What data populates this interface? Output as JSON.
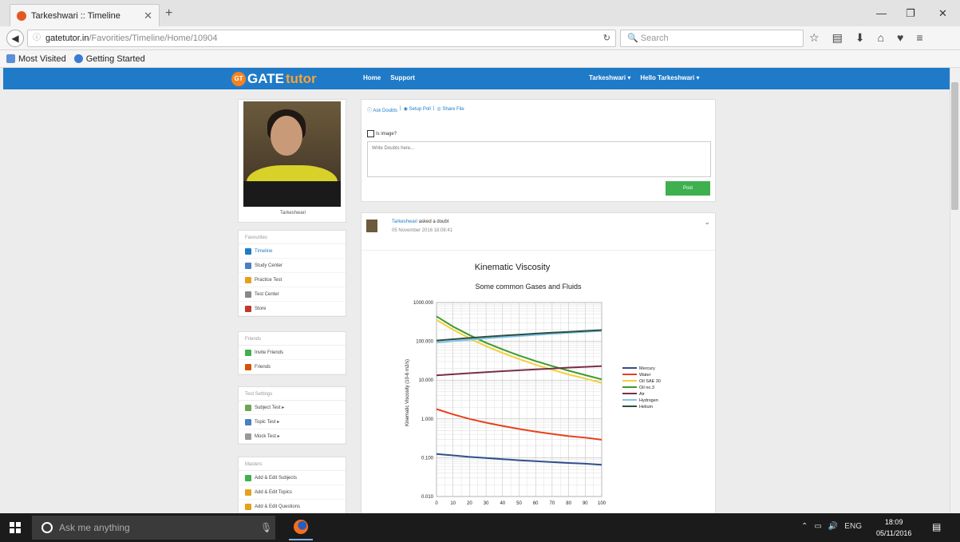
{
  "browser": {
    "tab_title": "Tarkeshwari :: Timeline",
    "url_host": "gatetutor.in",
    "url_path": "/Favorities/Timeline/Home/10904",
    "search_placeholder": "Search",
    "bookmarks": [
      "Most Visited",
      "Getting Started"
    ]
  },
  "site": {
    "logo_prefix": "GT",
    "logo_gate": "GATE",
    "logo_tutor": "tutor",
    "nav_left": [
      "Home",
      "Support"
    ],
    "nav_right": [
      "Tarkeshwari ▾",
      "Hello Tarkeshwari ▾"
    ]
  },
  "profile": {
    "name": "Tarkeshwari"
  },
  "sidebar": {
    "favourites": {
      "header": "Favourites",
      "items": [
        {
          "label": "Timeline",
          "color": "#1f7bc8"
        },
        {
          "label": "Study Center",
          "color": "#4a7fc1"
        },
        {
          "label": "Practice Test",
          "color": "#e3a21a"
        },
        {
          "label": "Test Center",
          "color": "#888888"
        },
        {
          "label": "Store",
          "color": "#c0392b"
        }
      ]
    },
    "friends": {
      "header": "Friends",
      "items": [
        {
          "label": "Invite Friends",
          "color": "#3eb04f"
        },
        {
          "label": "Friends",
          "color": "#d35400"
        }
      ]
    },
    "test_settings": {
      "header": "Test Settings",
      "items": [
        {
          "label": "Subject Test ▸",
          "color": "#6aa84f"
        },
        {
          "label": "Topic Test ▸",
          "color": "#4a7fc1"
        },
        {
          "label": "Mock Test ▸",
          "color": "#999999"
        }
      ]
    },
    "masters": {
      "header": "Masters",
      "items": [
        {
          "label": "Add & Edit Subjects",
          "color": "#3eb04f"
        },
        {
          "label": "Add & Edit Topics",
          "color": "#e3a21a"
        },
        {
          "label": "Add & Edit Questions",
          "color": "#e3a21a"
        }
      ]
    }
  },
  "composer": {
    "actions": [
      "Ask Doubts",
      "Setup Poll",
      "Share File"
    ],
    "is_image_label": "Is image?",
    "textarea_placeholder": "Write Doubts here...",
    "post_button": "Post"
  },
  "post": {
    "author": "Tarkeshwari",
    "action": "asked a doubt",
    "date": "05 November 2016 18:08:41"
  },
  "chart_data": {
    "type": "line",
    "title": "Kinematic Viscosity",
    "subtitle": "Some common Gases and Fluids",
    "ylabel": "Kinematic Viscosity (10-6 m2/s)",
    "xlabel": "",
    "xlim": [
      0,
      100
    ],
    "ylim": [
      0.01,
      1000
    ],
    "yscale": "log",
    "grid": true,
    "legend_position": "right",
    "x_ticks": [
      "0",
      "10",
      "20",
      "30",
      "40",
      "50",
      "60",
      "70",
      "80",
      "90",
      "100"
    ],
    "y_ticks": [
      "0.010",
      "0.100",
      "1.000",
      "10.000",
      "100.000",
      "1000.000"
    ],
    "x": [
      0,
      10,
      20,
      30,
      40,
      50,
      60,
      70,
      80,
      90,
      100
    ],
    "series": [
      {
        "name": "Mercury",
        "color": "#2e4f8c",
        "values": [
          0.125,
          0.115,
          0.105,
          0.098,
          0.092,
          0.086,
          0.081,
          0.077,
          0.073,
          0.07,
          0.066
        ]
      },
      {
        "name": "Water",
        "color": "#e8401c",
        "values": [
          1.79,
          1.31,
          1.0,
          0.8,
          0.66,
          0.55,
          0.47,
          0.41,
          0.36,
          0.33,
          0.29
        ]
      },
      {
        "name": "Oil SAE 30",
        "color": "#f2d13a",
        "values": [
          360,
          200,
          120,
          75,
          50,
          35,
          25,
          18.5,
          14,
          11,
          8.5
        ]
      },
      {
        "name": "Oil no.3",
        "color": "#3f9a2e",
        "values": [
          440,
          240,
          145,
          92,
          62,
          43,
          31,
          23,
          17.5,
          13.5,
          10.5
        ]
      },
      {
        "name": "Air",
        "color": "#7a2e45",
        "values": [
          13.3,
          14.1,
          15.1,
          16.0,
          17.0,
          17.9,
          18.9,
          19.9,
          21.0,
          22.0,
          23.0
        ]
      },
      {
        "name": "Hydrogen",
        "color": "#7fc4ea",
        "values": [
          93,
          102,
          110,
          119,
          128,
          137,
          146,
          156,
          165,
          175,
          185
        ]
      },
      {
        "name": "Helium",
        "color": "#2b4f3e",
        "values": [
          105,
          113,
          122,
          131,
          140,
          149,
          158,
          167,
          176,
          185,
          195
        ]
      }
    ]
  },
  "taskbar": {
    "search_placeholder": "Ask me anything",
    "lang": "ENG",
    "time": "18:09",
    "date": "05/11/2016"
  }
}
